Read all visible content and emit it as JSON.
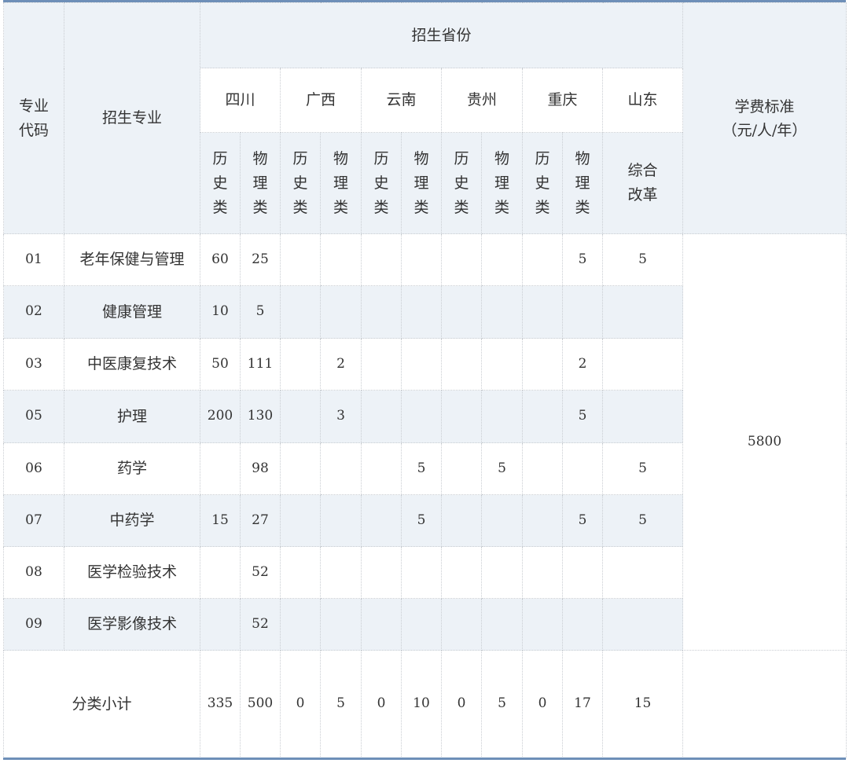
{
  "header": {
    "code_label": "专业代码",
    "major_label": "招生专业",
    "province_group_label": "招生省份",
    "tuition_label_line1": "学费标准",
    "tuition_label_line2": "（元/人/年）"
  },
  "provinces": [
    {
      "name": "四川",
      "tracks": [
        "历史类",
        "物理类"
      ]
    },
    {
      "name": "广西",
      "tracks": [
        "历史类",
        "物理类"
      ]
    },
    {
      "name": "云南",
      "tracks": [
        "历史类",
        "物理类"
      ]
    },
    {
      "name": "贵州",
      "tracks": [
        "历史类",
        "物理类"
      ]
    },
    {
      "name": "重庆",
      "tracks": [
        "历史类",
        "物理类"
      ]
    },
    {
      "name": "山东",
      "tracks": [
        "综合改革"
      ]
    }
  ],
  "rows": [
    {
      "code": "01",
      "major": "老年保健与管理",
      "cells": [
        "60",
        "25",
        "",
        "",
        "",
        "",
        "",
        "",
        "",
        "5",
        "5"
      ]
    },
    {
      "code": "02",
      "major": "健康管理",
      "cells": [
        "10",
        "5",
        "",
        "",
        "",
        "",
        "",
        "",
        "",
        "",
        ""
      ]
    },
    {
      "code": "03",
      "major": "中医康复技术",
      "cells": [
        "50",
        "111",
        "",
        "2",
        "",
        "",
        "",
        "",
        "",
        "2",
        ""
      ]
    },
    {
      "code": "05",
      "major": "护理",
      "cells": [
        "200",
        "130",
        "",
        "3",
        "",
        "",
        "",
        "",
        "",
        "5",
        ""
      ]
    },
    {
      "code": "06",
      "major": "药学",
      "cells": [
        "",
        "98",
        "",
        "",
        "",
        "5",
        "",
        "5",
        "",
        "",
        "5"
      ]
    },
    {
      "code": "07",
      "major": "中药学",
      "cells": [
        "15",
        "27",
        "",
        "",
        "",
        "5",
        "",
        "",
        "",
        "5",
        "5"
      ]
    },
    {
      "code": "08",
      "major": "医学检验技术",
      "cells": [
        "",
        "52",
        "",
        "",
        "",
        "",
        "",
        "",
        "",
        "",
        ""
      ]
    },
    {
      "code": "09",
      "major": "医学影像技术",
      "cells": [
        "",
        "52",
        "",
        "",
        "",
        "",
        "",
        "",
        "",
        "",
        ""
      ]
    }
  ],
  "tuition": "5800",
  "subtotal": {
    "label": "分类小计",
    "cells": [
      "335",
      "500",
      "0",
      "5",
      "0",
      "10",
      "0",
      "5",
      "0",
      "17",
      "15"
    ]
  }
}
